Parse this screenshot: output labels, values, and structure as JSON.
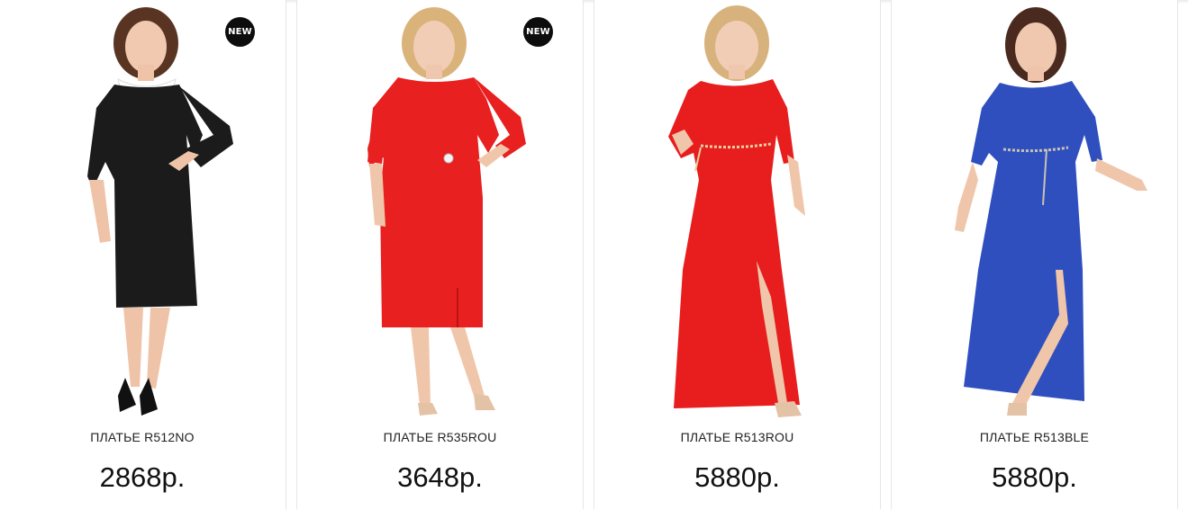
{
  "products": [
    {
      "badge": "NEW",
      "name": "ПЛАТЬЕ R512NO",
      "price": "2868р.",
      "dress_color": "#1b1b1b",
      "hair_color": "#5a3422"
    },
    {
      "badge": "NEW",
      "name": "ПЛАТЬЕ R535ROU",
      "price": "3648р.",
      "dress_color": "#e8201f",
      "hair_color": "#d9b37a"
    },
    {
      "badge": "",
      "name": "ПЛАТЬЕ R513ROU",
      "price": "5880р.",
      "dress_color": "#e81d1d",
      "hair_color": "#d8b27c"
    },
    {
      "badge": "",
      "name": "ПЛАТЬЕ R513BLE",
      "price": "5880р.",
      "dress_color": "#2f4fbf",
      "hair_color": "#4a2a1e"
    }
  ]
}
